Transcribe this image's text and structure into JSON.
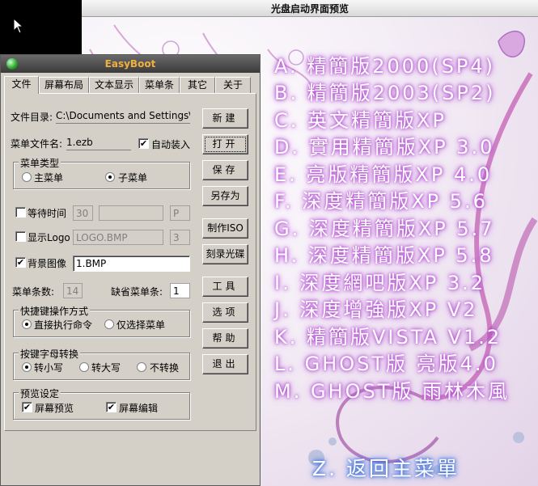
{
  "preview": {
    "title": "光盘启动界面预览",
    "menu_items": [
      "A. 精簡版2000(SP4)",
      "B. 精簡版2003(SP2)",
      "C. 英文精簡版XP",
      "D. 實用精簡版XP 3.0",
      "E. 亮版精簡版XP 4.0",
      "F. 深度精簡版XP 5.6",
      "G. 深度精簡版XP 5.7",
      "H. 深度精簡版XP 5.8",
      "I. 深度網吧版XP 3.2",
      "J. 深度增強版XP V2",
      "K. 精簡版VISTA V1.2",
      "L. GHOST版 亮版4.0",
      "M. GHOST版 雨林木風"
    ],
    "return_item": "Z. 返回主菜單"
  },
  "dialog": {
    "title": "EasyBoot",
    "tabs": [
      "文件",
      "屏幕布局",
      "文本显示",
      "菜单条",
      "其它",
      "关于"
    ],
    "file_dir_label": "文件目录:",
    "file_dir_value": "C:\\Documents and Settings\\Admin",
    "menu_file_label": "菜单文件名:",
    "menu_file_value": "1.ezb",
    "auto_load_label": "自动装入",
    "menu_type_group": "菜单类型",
    "main_menu_label": "主菜单",
    "sub_menu_label": "子菜单",
    "wait_time_label": "等待时间",
    "wait_time_value": "30",
    "wait_key_value": "P",
    "show_logo_label": "显示Logo",
    "logo_file_value": "LOGO.BMP",
    "logo_num_value": "3",
    "bg_image_label": "背景图像",
    "bg_image_value": "1.BMP",
    "menu_count_label": "菜单条数:",
    "menu_count_value": "14",
    "default_menu_label": "缺省菜单条:",
    "default_menu_value": "1",
    "hotkey_group": "快捷键操作方式",
    "exec_cmd_label": "直接执行命令",
    "select_only_label": "仅选择菜单",
    "case_group": "按键字母转换",
    "to_lower_label": "转小写",
    "to_upper_label": "转大写",
    "no_convert_label": "不转换",
    "preview_group": "预览设定",
    "screen_preview_label": "屏幕预览",
    "screen_edit_label": "屏幕编辑",
    "buttons": {
      "new": "新建",
      "open": "打开",
      "save": "保存",
      "save_as": "另存为",
      "make_iso": "制作ISO",
      "burn": "刻录光碟",
      "tools": "工具",
      "options": "选项",
      "help": "帮助",
      "exit": "退出"
    }
  }
}
